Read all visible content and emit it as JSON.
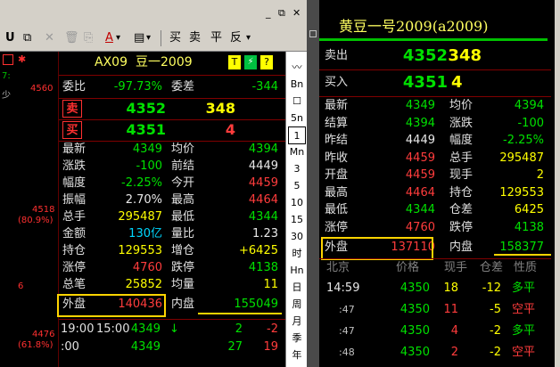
{
  "left": {
    "toolbar": {
      "items": [
        "U",
        "⧉",
        "✕",
        "🗑",
        "⎘",
        "A",
        "▾",
        "▤",
        "▾",
        "买",
        "卖",
        "平",
        "反",
        "▾"
      ]
    },
    "window_controls": [
      "_",
      "⧉",
      "✕"
    ],
    "strip_labels": [
      "7:",
      "少"
    ],
    "chart_labels": {
      "top": "4560",
      "mid_price": "4518",
      "mid_pct": "(80.9%)",
      "bot_price": "4476",
      "bot_pct": "(61.8%)",
      "side_6": "6"
    },
    "header": {
      "code": "AX09",
      "name": "豆一2009",
      "badges": [
        "T",
        "⚡",
        "?"
      ]
    },
    "weibi": {
      "label": "委比",
      "value": "-97.73%",
      "label2": "委差",
      "value2": "-344"
    },
    "sell": {
      "label": "卖",
      "price": "4352",
      "qty": "348"
    },
    "buy": {
      "label": "买",
      "price": "4351",
      "qty": "4"
    },
    "grid": [
      {
        "k1": "最新",
        "v1": "4349",
        "c1": "g",
        "k2": "均价",
        "v2": "4394",
        "c2": "g"
      },
      {
        "k1": "涨跌",
        "v1": "-100",
        "c1": "g",
        "k2": "前结",
        "v2": "4449",
        "c2": "w"
      },
      {
        "k1": "幅度",
        "v1": "-2.25%",
        "c1": "g",
        "k2": "今开",
        "v2": "4459",
        "c2": "r"
      },
      {
        "k1": "振幅",
        "v1": "2.70%",
        "c1": "w",
        "k2": "最高",
        "v2": "4464",
        "c2": "r"
      },
      {
        "k1": "总手",
        "v1": "295487",
        "c1": "y",
        "k2": "最低",
        "v2": "4344",
        "c2": "g"
      },
      {
        "k1": "金额",
        "v1": "130亿",
        "c1": "c",
        "k2": "量比",
        "v2": "1.23",
        "c2": "w"
      },
      {
        "k1": "持仓",
        "v1": "129553",
        "c1": "y",
        "k2": "增仓",
        "v2": "+6425",
        "c2": "y"
      },
      {
        "k1": "涨停",
        "v1": "4760",
        "c1": "r",
        "k2": "跌停",
        "v2": "4138",
        "c2": "g"
      },
      {
        "k1": "总笔",
        "v1": "25852",
        "c1": "y",
        "k2": "均量",
        "v2": "11",
        "c2": "y"
      }
    ],
    "waipan": {
      "label": "外盘",
      "value": "140436",
      "label2": "内盘",
      "value2": "155049"
    },
    "ticks": [
      {
        "time": "19:00",
        "time2": "15:00",
        "price": "4349",
        "arrow": "↓",
        "vol": "2",
        "chg": "-2"
      },
      {
        "time": ":00",
        "time2": "",
        "price": "4349",
        "arrow": "",
        "vol": "27",
        "chg": "19"
      }
    ],
    "sidebar": [
      "〰",
      "Bn",
      "☐",
      "5n",
      "1",
      "Mn",
      "3",
      "5",
      "10",
      "15",
      "30",
      "时",
      "Hn",
      "日",
      "周",
      "月",
      "季",
      "年"
    ]
  },
  "right": {
    "title": "黄豆一号2009(a2009)",
    "sell": {
      "label": "卖出",
      "price": "4352",
      "qty": "348"
    },
    "buy": {
      "label": "买入",
      "price": "4351",
      "qty": "4"
    },
    "grid": [
      {
        "k1": "最新",
        "v1": "4349",
        "c1": "g",
        "k2": "均价",
        "v2": "4394",
        "c2": "g"
      },
      {
        "k1": "结算",
        "v1": "4394",
        "c1": "g",
        "k2": "涨跌",
        "v2": "-100",
        "c2": "g"
      },
      {
        "k1": "昨结",
        "v1": "4449",
        "c1": "w",
        "k2": "幅度",
        "v2": "-2.25%",
        "c2": "g"
      },
      {
        "k1": "昨收",
        "v1": "4459",
        "c1": "r",
        "k2": "总手",
        "v2": "295487",
        "c2": "y"
      },
      {
        "k1": "开盘",
        "v1": "4459",
        "c1": "r",
        "k2": "现手",
        "v2": "2",
        "c2": "y"
      },
      {
        "k1": "最高",
        "v1": "4464",
        "c1": "r",
        "k2": "持仓",
        "v2": "129553",
        "c2": "y"
      },
      {
        "k1": "最低",
        "v1": "4344",
        "c1": "g",
        "k2": "仓差",
        "v2": "6425",
        "c2": "y"
      },
      {
        "k1": "涨停",
        "v1": "4760",
        "c1": "r",
        "k2": "跌停",
        "v2": "4138",
        "c2": "g"
      }
    ],
    "waipan": {
      "label": "外盘",
      "value": "137110",
      "label2": "内盘",
      "value2": "158377"
    },
    "tick_headers": [
      "北京",
      "价格",
      "现手",
      "仓差",
      "性质"
    ],
    "ticks": [
      {
        "time": "14:59",
        "price": "4350",
        "vol": "18",
        "chg": "-12",
        "nature": "多平",
        "nc": "g"
      },
      {
        "time": ":47",
        "price": "4350",
        "vol": "11",
        "chg": "-5",
        "nature": "空平",
        "nc": "r"
      },
      {
        "time": ":47",
        "price": "4350",
        "vol": "4",
        "chg": "-2",
        "nature": "多平",
        "nc": "g"
      },
      {
        "time": ":48",
        "price": "4350",
        "vol": "2",
        "chg": "-2",
        "nature": "空平",
        "nc": "r"
      }
    ]
  }
}
